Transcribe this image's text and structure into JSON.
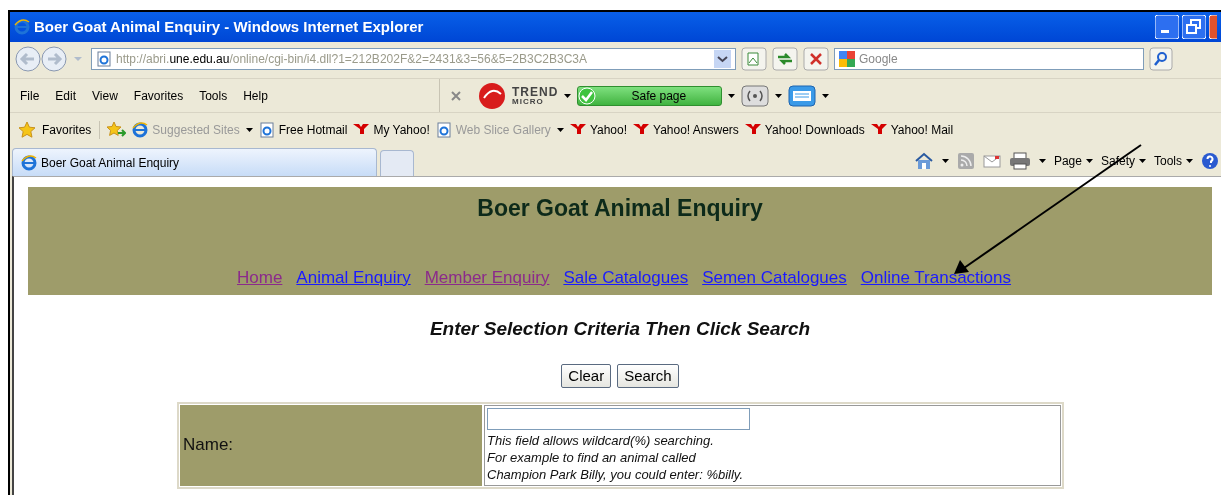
{
  "window": {
    "title": "Boer Goat Animal Enquiry - Windows Internet Explorer"
  },
  "address_bar": {
    "url_prefix": "http://abri.",
    "url_domain": "une.edu.au",
    "url_path": "/online/cgi-bin/i4.dll?1=212B202F&2=2431&3=56&5=2B3C2B3C3A",
    "search_placeholder": "Google"
  },
  "menu": [
    "File",
    "Edit",
    "View",
    "Favorites",
    "Tools",
    "Help"
  ],
  "trend_toolbar": {
    "brand": "TREND",
    "sub": "MICRO",
    "status": "Safe page"
  },
  "favorites_bar": {
    "label": "Favorites",
    "items": [
      {
        "label": "Suggested Sites",
        "kind": "ie",
        "dimmed": true,
        "dropdown": true
      },
      {
        "label": "Free Hotmail",
        "kind": "page",
        "dimmed": false,
        "dropdown": false
      },
      {
        "label": "My Yahoo!",
        "kind": "yahoo",
        "dimmed": false,
        "dropdown": false
      },
      {
        "label": "Web Slice Gallery",
        "kind": "page",
        "dimmed": true,
        "dropdown": true
      },
      {
        "label": "Yahoo!",
        "kind": "yahoo",
        "dimmed": false,
        "dropdown": false
      },
      {
        "label": "Yahoo! Answers",
        "kind": "yahoo",
        "dimmed": false,
        "dropdown": false
      },
      {
        "label": "Yahoo! Downloads",
        "kind": "yahoo",
        "dimmed": false,
        "dropdown": false
      },
      {
        "label": "Yahoo! Mail",
        "kind": "yahoo",
        "dimmed": false,
        "dropdown": false
      }
    ]
  },
  "tabs": [
    {
      "label": "Boer Goat Animal Enquiry",
      "selected": true
    }
  ],
  "command_bar": [
    "Page",
    "Safety",
    "Tools"
  ],
  "page": {
    "heading": "Boer Goat Animal Enquiry",
    "nav": [
      {
        "label": "Home",
        "visited": true
      },
      {
        "label": "Animal Enquiry",
        "visited": false
      },
      {
        "label": "Member Enquiry",
        "visited": true
      },
      {
        "label": "Sale Catalogues",
        "visited": false
      },
      {
        "label": "Semen Catalogues",
        "visited": false
      },
      {
        "label": "Online Transactions",
        "visited": false
      }
    ],
    "subtitle": "Enter Selection Criteria Then Click Search",
    "buttons": [
      "Clear",
      "Search"
    ],
    "form": [
      {
        "label": "Name:",
        "help": [
          "This field allows wildcard(%) searching.",
          "For example to find an animal called",
          "Champion Park Billy, you could enter: %billy."
        ]
      }
    ]
  }
}
